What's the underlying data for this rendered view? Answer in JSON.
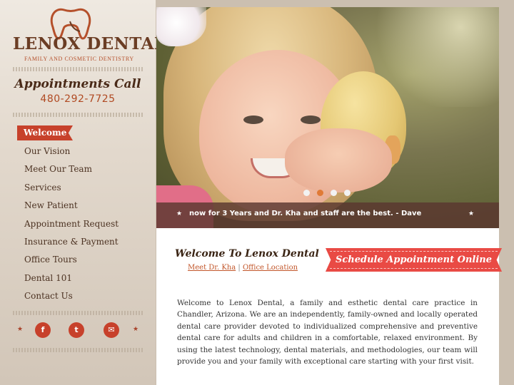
{
  "brand": {
    "logo_text": "LENOX DENTAL",
    "tagline": "FAMILY AND COSMETIC DENTISTRY"
  },
  "appointments": {
    "title": "Appointments Call",
    "phone": "480-292-7725"
  },
  "nav": {
    "items": [
      {
        "label": "Welcome",
        "active": true
      },
      {
        "label": "Our Vision"
      },
      {
        "label": "Meet Our Team"
      },
      {
        "label": "Services"
      },
      {
        "label": "New Patient"
      },
      {
        "label": "Appointment Request"
      },
      {
        "label": "Insurance & Payment"
      },
      {
        "label": "Office Tours"
      },
      {
        "label": "Dental 101"
      },
      {
        "label": "Contact Us"
      }
    ]
  },
  "social": {
    "icons": [
      "facebook-icon",
      "twitter-icon",
      "email-icon"
    ],
    "glyphs": [
      "f",
      "t",
      "✉"
    ]
  },
  "hero": {
    "testimonial": "now for 3 Years and Dr. Kha and staff are the best. - Dave",
    "slide_count": 4,
    "active_slide": 2
  },
  "welcome": {
    "title": "Welcome To Lenox Dental",
    "link_meet": "Meet Dr. Kha",
    "separator": "|",
    "link_office": "Office Location",
    "schedule_label": "Schedule Appointment Online",
    "body": "Welcome to Lenox Dental, a family and esthetic dental care practice in Chandler, Arizona. We are an independently, family-owned and locally operated dental care provider devoted to individualized comprehensive and preventive dental care for adults and children in a comfortable, relaxed environment. By using the latest technology, dental materials, and methodologies, our team will provide you and your family with exceptional care starting with your first visit."
  },
  "colors": {
    "accent": "#c7412b",
    "schedule_banner": "#e94a44",
    "brown": "#4a2a18"
  }
}
